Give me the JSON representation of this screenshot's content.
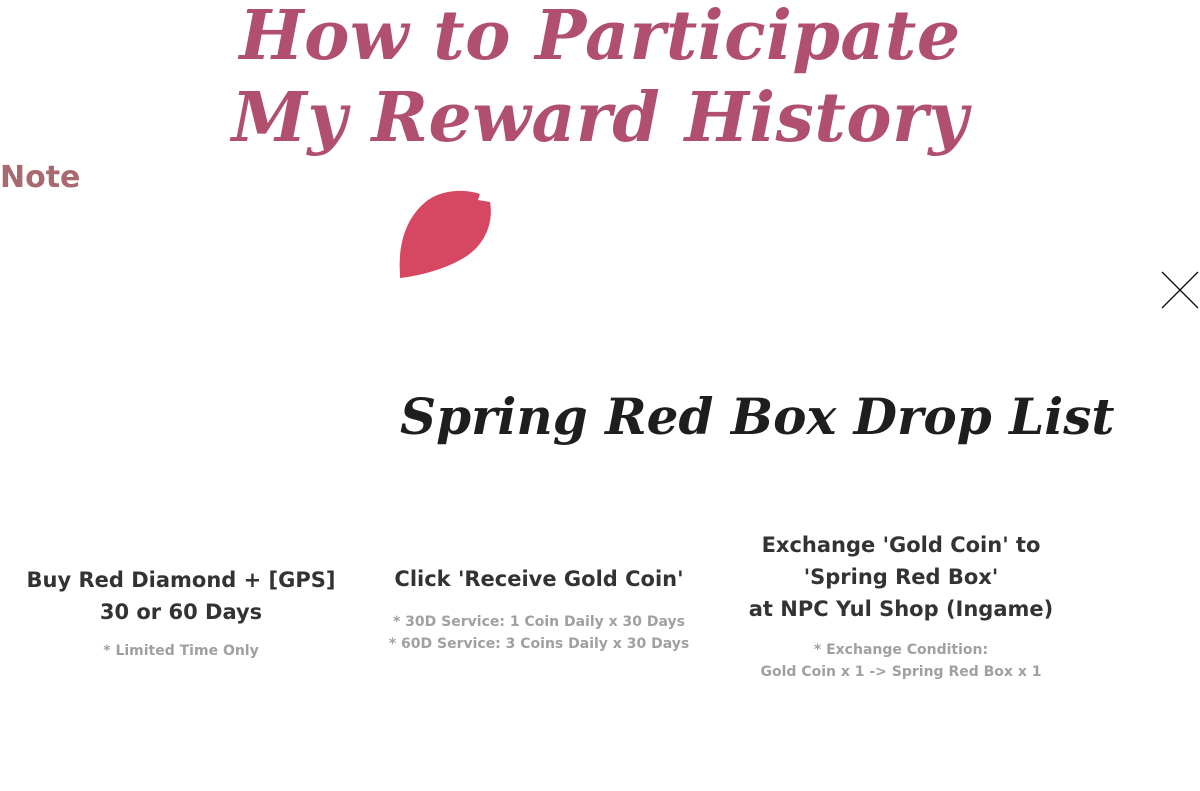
{
  "header": {
    "title_line1": "How to Participate",
    "title_line2": "My Reward History",
    "note_label": "Note"
  },
  "colors": {
    "title_accent": "#b0506e",
    "note_label": "#a86a6f",
    "petal": "#d64861",
    "heading_dark": "#1e1e1e",
    "step_text": "#333333",
    "step_note": "#a0a0a0"
  },
  "decor": {
    "petal_icon": "petal-icon",
    "close_icon": "close-icon"
  },
  "drop_list": {
    "title": "Spring Red Box Drop List"
  },
  "steps": [
    {
      "title": "Buy Red Diamond + [GPS]\n30 or 60 Days",
      "note": "* Limited Time Only"
    },
    {
      "title": "Click 'Receive Gold Coin'",
      "note": "* 30D Service: 1 Coin Daily x 30 Days\n* 60D Service: 3 Coins Daily x 30 Days"
    },
    {
      "title": "Exchange 'Gold Coin' to\n'Spring Red Box'\nat NPC Yul Shop (Ingame)",
      "note": "* Exchange Condition:\nGold Coin x 1 -> Spring Red Box x 1"
    }
  ]
}
